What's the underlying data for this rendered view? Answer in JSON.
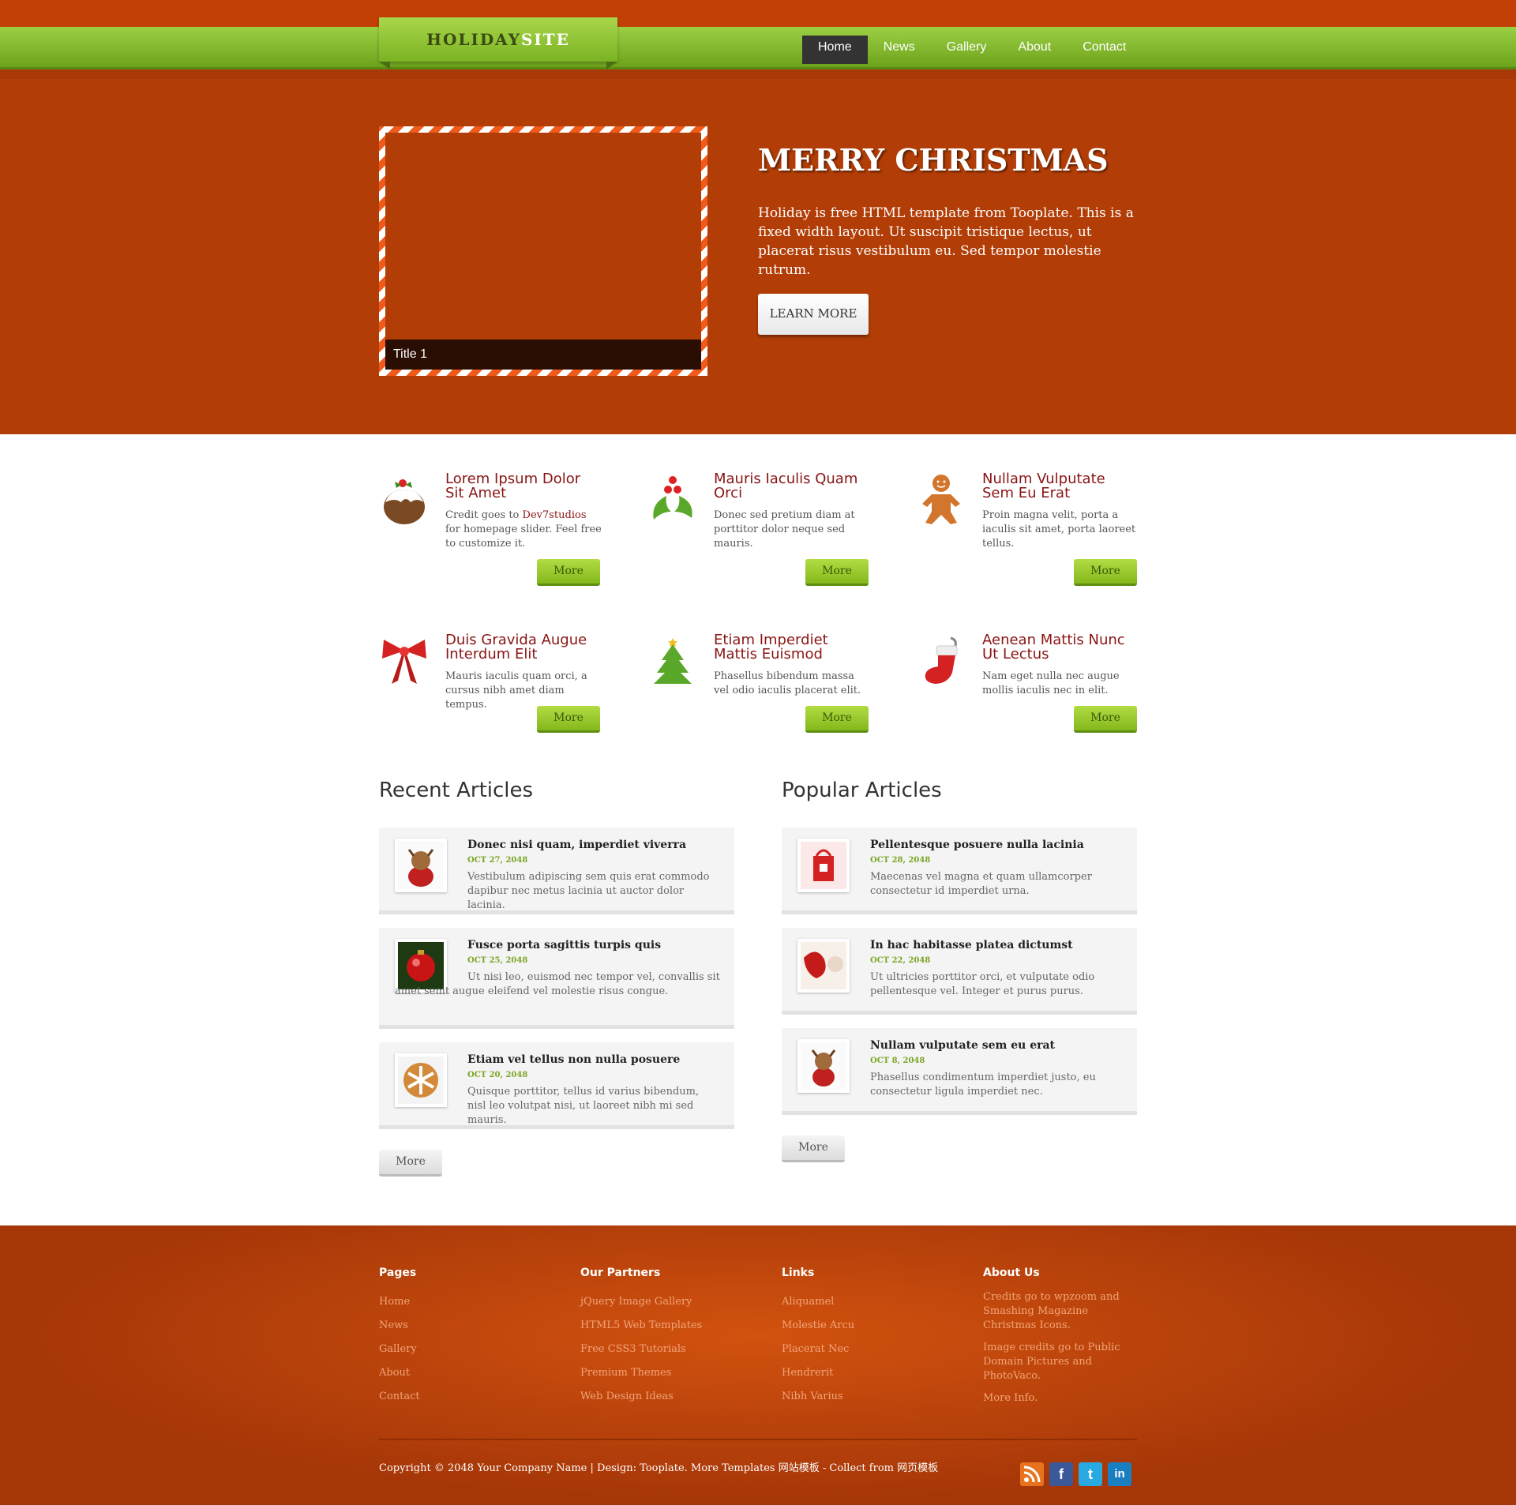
{
  "header": {
    "logo_part1": "HOLIDAY",
    "logo_part2": "SITE",
    "menu": [
      "Home",
      "News",
      "Gallery",
      "About",
      "Contact"
    ]
  },
  "hero": {
    "slide_title": "Title 1",
    "title": "MERRY CHRISTMAS",
    "text": "Holiday is free HTML template from Tooplate. This is a fixed width layout. Ut suscipit tristique lectus, ut placerat risus vestibulum eu. Sed tempor molestie rutrum.",
    "button": "LEARN MORE"
  },
  "features": [
    {
      "icon": "pudding-icon",
      "title": "Lorem Ipsum Dolor Sit Amet",
      "text_before": "Credit goes to ",
      "text_link": "Dev7studios",
      "text_after": " for homepage slider. Feel free to customize it.",
      "button": "More"
    },
    {
      "icon": "holly-icon",
      "title": "Mauris Iaculis Quam Orci",
      "text": "Donec sed pretium diam at porttitor dolor neque sed mauris.",
      "button": "More"
    },
    {
      "icon": "gingerbread-man-icon",
      "title": "Nullam Vulputate Sem Eu Erat",
      "text": "Proin magna velit, porta a iaculis sit amet, porta laoreet tellus.",
      "button": "More"
    },
    {
      "icon": "bow-icon",
      "title": "Duis Gravida Augue Interdum Elit",
      "text": "Mauris iaculis quam orci, a cursus nibh amet diam tempus.",
      "button": "More"
    },
    {
      "icon": "christmas-tree-icon",
      "title": "Etiam Imperdiet Mattis Euismod",
      "text": "Phasellus bibendum massa vel odio iaculis placerat elit.",
      "button": "More"
    },
    {
      "icon": "stocking-icon",
      "title": "Aenean Mattis Nunc Ut Lectus",
      "text": "Nam eget nulla nec augue mollis iaculis nec in elit.",
      "button": "More"
    }
  ],
  "recent": {
    "title": "Recent Articles",
    "button": "More",
    "items": [
      {
        "title": "Donec nisi quam, imperdiet viverra",
        "date": "OCT 27, 2048",
        "text": "Vestibulum adipiscing sem quis erat commodo dapibur nec metus lacinia ut auctor dolor lacinia."
      },
      {
        "title": "Fusce porta sagittis turpis quis",
        "date": "OCT 25, 2048",
        "text": "Ut nisi leo, euismod nec tempor vel, convallis sit amet semt augue eleifend vel molestie risus congue."
      },
      {
        "title": "Etiam vel tellus non nulla posuere",
        "date": "OCT 20, 2048",
        "text": "Quisque porttitor, tellus id varius bibendum, nisl leo volutpat nisi, ut laoreet nibh mi sed mauris."
      }
    ]
  },
  "popular": {
    "title": "Popular Articles",
    "button": "More",
    "items": [
      {
        "title": "Pellentesque posuere nulla lacinia",
        "date": "OCT 28, 2048",
        "text": "Maecenas vel magna et quam ullamcorper consectetur id imperdiet urna."
      },
      {
        "title": "In hac habitasse platea dictumst",
        "date": "OCT 22, 2048",
        "text": "Ut ultricies porttitor orci, et vulputate odio pellentesque vel. Integer et purus purus."
      },
      {
        "title": "Nullam vulputate sem eu erat",
        "date": "OCT 8, 2048",
        "text": "Phasellus condimentum imperdiet justo, eu consectetur ligula imperdiet nec."
      }
    ]
  },
  "footer": {
    "pages": {
      "title": "Pages",
      "links": [
        "Home",
        "News",
        "Gallery",
        "About",
        "Contact"
      ]
    },
    "partners": {
      "title": "Our Partners",
      "links": [
        "jQuery Image Gallery",
        "HTML5 Web Templates",
        "Free CSS3 Tutorials",
        "Premium Themes",
        "Web Design Ideas"
      ]
    },
    "links": {
      "title": "Links",
      "links": [
        "Aliquamel",
        "Molestie Arcu",
        "Placerat Nec",
        "Hendrerit",
        "Nibh Varius"
      ]
    },
    "about": {
      "title": "About Us",
      "p1": "Credits go to wpzoom and Smashing Magazine Christmas Icons.",
      "p2": "Image credits go to Public Domain Pictures and PhotoVaco.",
      "more": "More Info."
    },
    "copyright": "Copyright © 2048 Your Company Name | Design: Tooplate. More Templates 网站模板 - Collect from 网页模板",
    "social": [
      "rss-icon",
      "facebook-icon",
      "twitter-icon",
      "linkedin-icon"
    ]
  },
  "colors": {
    "orange": "#b23d06",
    "green": "#84b81b",
    "dark_red": "#8a1414"
  }
}
